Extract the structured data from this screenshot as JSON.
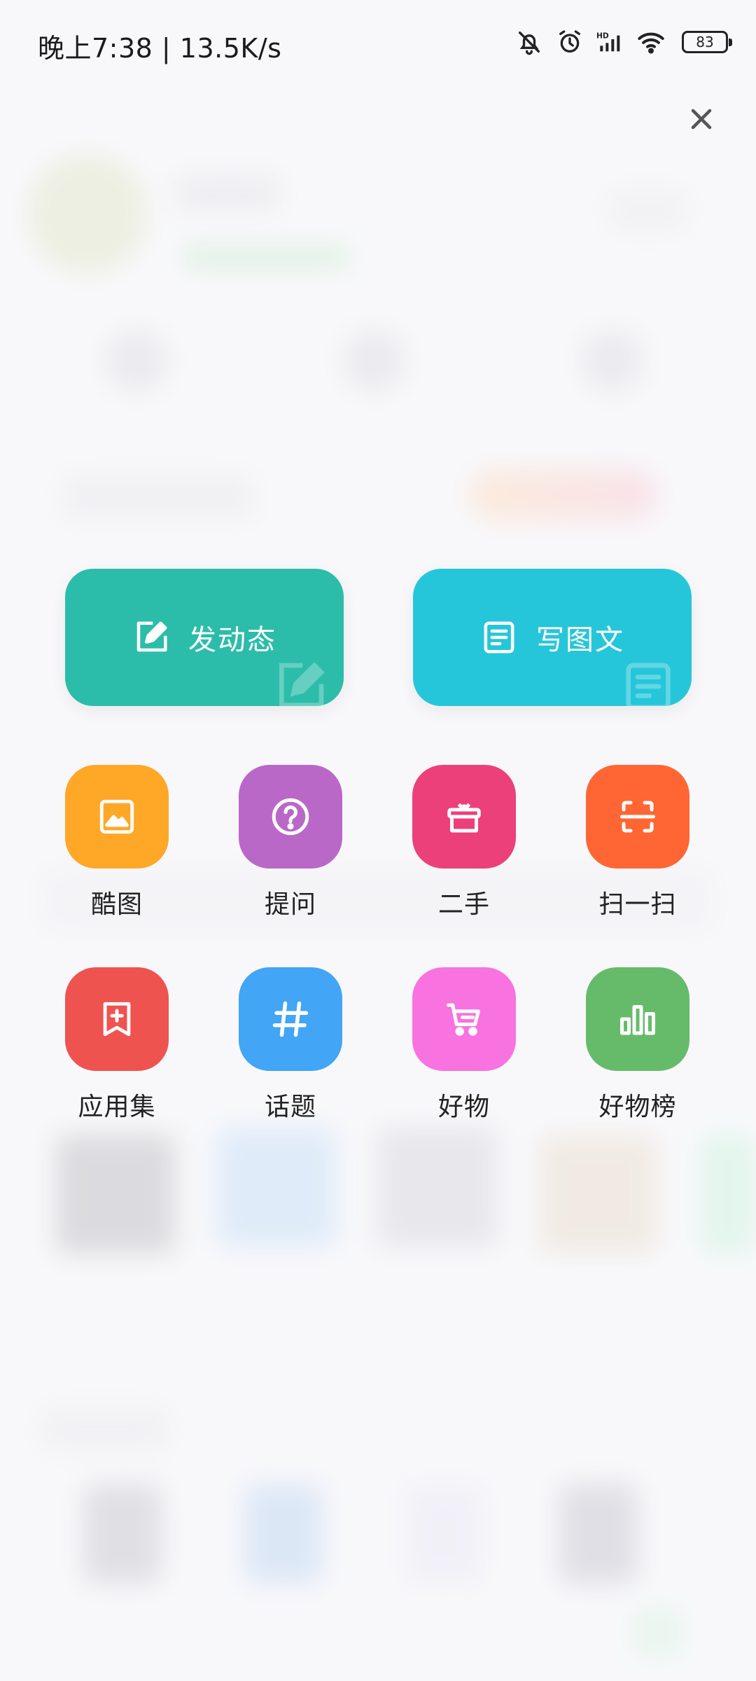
{
  "status_bar": {
    "time_text": "晚上7:38 | 13.5K/s",
    "battery_level": "83",
    "icons": [
      "bell-off-icon",
      "alarm-icon",
      "hd-signal-icon",
      "wifi-icon",
      "battery-icon"
    ]
  },
  "overlay": {
    "close_icon": "close-icon"
  },
  "primary_actions": [
    {
      "label": "发动态",
      "icon": "edit-square-icon",
      "color": "#2bbdaa"
    },
    {
      "label": "写图文",
      "icon": "article-icon",
      "color": "#26c6da"
    }
  ],
  "grid_items": [
    {
      "label": "酷图",
      "icon": "image-icon",
      "color": "#ffa726"
    },
    {
      "label": "提问",
      "icon": "question-icon",
      "color": "#ba68c8"
    },
    {
      "label": "二手",
      "icon": "gift-box-icon",
      "color": "#ec407a"
    },
    {
      "label": "扫一扫",
      "icon": "scan-icon",
      "color": "#ff6633"
    },
    {
      "label": "应用集",
      "icon": "bookmark-add-icon",
      "color": "#ef5350"
    },
    {
      "label": "话题",
      "icon": "hashtag-icon",
      "color": "#42a5f5"
    },
    {
      "label": "好物",
      "icon": "cart-icon",
      "color": "#f872e0"
    },
    {
      "label": "好物榜",
      "icon": "bar-chart-icon",
      "color": "#66bb6a"
    }
  ]
}
